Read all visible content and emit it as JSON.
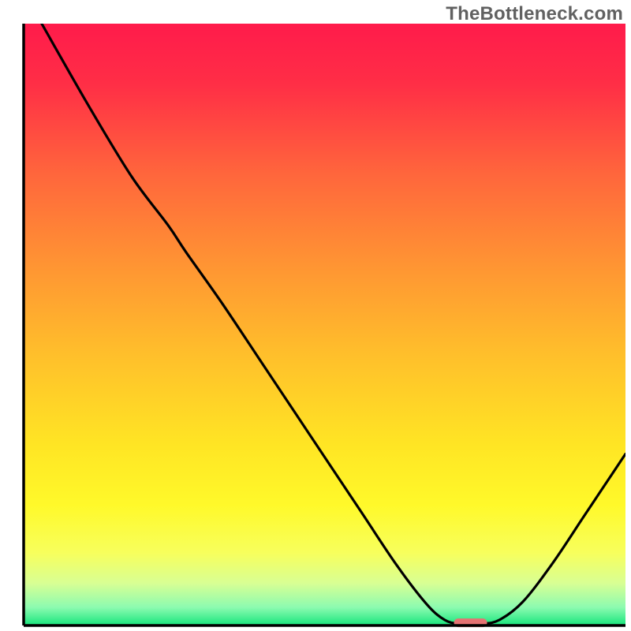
{
  "watermark": "TheBottleneck.com",
  "chart_data": {
    "type": "line",
    "xlim": [
      0,
      100
    ],
    "ylim": [
      0,
      100
    ],
    "xlabel": "",
    "ylabel": "",
    "title": "",
    "gradient_stops": [
      {
        "offset": 0.0,
        "color": "#ff1b4b"
      },
      {
        "offset": 0.1,
        "color": "#ff2e46"
      },
      {
        "offset": 0.25,
        "color": "#ff663c"
      },
      {
        "offset": 0.4,
        "color": "#ff9433"
      },
      {
        "offset": 0.55,
        "color": "#ffbf2b"
      },
      {
        "offset": 0.7,
        "color": "#ffe524"
      },
      {
        "offset": 0.8,
        "color": "#fff92a"
      },
      {
        "offset": 0.88,
        "color": "#f7ff5d"
      },
      {
        "offset": 0.93,
        "color": "#d8ff94"
      },
      {
        "offset": 0.97,
        "color": "#8cfbb0"
      },
      {
        "offset": 1.0,
        "color": "#17e57c"
      }
    ],
    "series": [
      {
        "name": "bottleneck-curve",
        "color": "#000000",
        "points": [
          {
            "x": 3.0,
            "y": 100.0
          },
          {
            "x": 11.0,
            "y": 86.0
          },
          {
            "x": 18.0,
            "y": 74.5
          },
          {
            "x": 24.0,
            "y": 66.5
          },
          {
            "x": 27.0,
            "y": 62.0
          },
          {
            "x": 33.0,
            "y": 53.5
          },
          {
            "x": 40.0,
            "y": 43.0
          },
          {
            "x": 48.0,
            "y": 31.0
          },
          {
            "x": 56.0,
            "y": 19.0
          },
          {
            "x": 62.0,
            "y": 10.0
          },
          {
            "x": 67.0,
            "y": 3.5
          },
          {
            "x": 70.0,
            "y": 0.9
          },
          {
            "x": 72.5,
            "y": 0.3
          },
          {
            "x": 76.0,
            "y": 0.3
          },
          {
            "x": 79.0,
            "y": 0.9
          },
          {
            "x": 83.0,
            "y": 4.0
          },
          {
            "x": 88.0,
            "y": 10.5
          },
          {
            "x": 93.0,
            "y": 18.0
          },
          {
            "x": 97.0,
            "y": 24.0
          },
          {
            "x": 100.0,
            "y": 28.5
          }
        ]
      }
    ],
    "marker": {
      "name": "optimal-range-marker",
      "x_start": 71.5,
      "x_end": 77.0,
      "y": 0.45,
      "color": "#e57373"
    },
    "axes": {
      "color": "#000000",
      "thickness": 3.5
    }
  }
}
